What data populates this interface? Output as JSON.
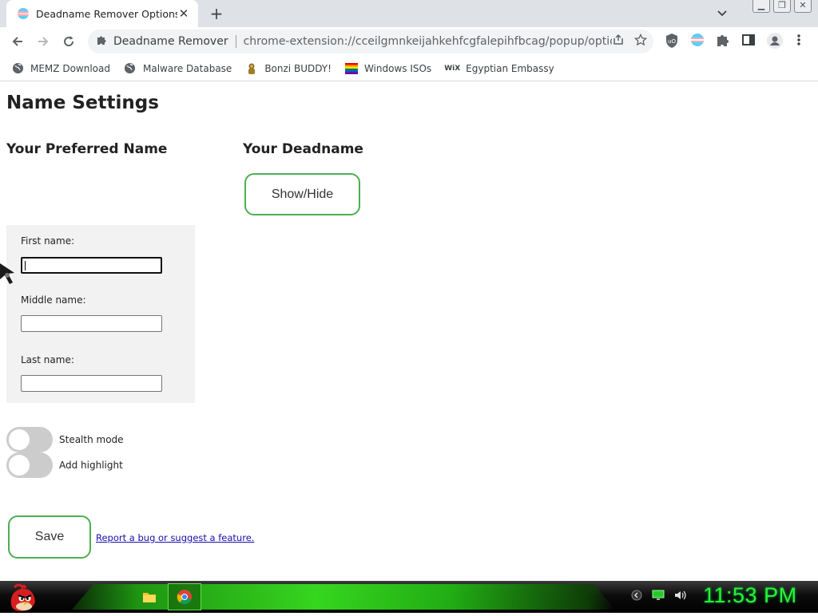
{
  "browser": {
    "tab_title": "Deadname Remover Options",
    "close_glyph": "✕",
    "new_tab_glyph": "+",
    "omnibox": {
      "site_label": "Deadname Remover",
      "url": "chrome-extension://cceilgmnkeijahkehfcgfalepihfbcag/popup/options.html"
    },
    "bookmarks": [
      {
        "label": "MEMZ Download",
        "icon": "globe-icon"
      },
      {
        "label": "Malware Database",
        "icon": "globe-icon"
      },
      {
        "label": "Bonzi BUDDY!",
        "icon": "bonzi-icon"
      },
      {
        "label": "Windows ISOs",
        "icon": "rainbow-flag-icon"
      },
      {
        "label": "Egyptian Embassy",
        "icon": "wix-icon"
      }
    ],
    "wix_text": "WiX"
  },
  "page": {
    "title": "Name Settings",
    "preferred_heading": "Your Preferred Name",
    "deadname_heading": "Your Deadname",
    "show_hide_label": "Show/Hide",
    "fields": {
      "first_label": "First name:",
      "first_value": "",
      "middle_label": "Middle name:",
      "middle_value": "",
      "last_label": "Last name:",
      "last_value": ""
    },
    "toggles": {
      "stealth_label": "Stealth mode",
      "stealth_on": false,
      "highlight_label": "Add highlight",
      "highlight_on": false
    },
    "save_label": "Save",
    "bug_link": "Report a bug or suggest a feature."
  },
  "taskbar": {
    "clock": "11:53 PM"
  },
  "colors": {
    "accent_green": "#4caf50",
    "clock_green": "#27f52a",
    "link": "#1a0dab"
  }
}
